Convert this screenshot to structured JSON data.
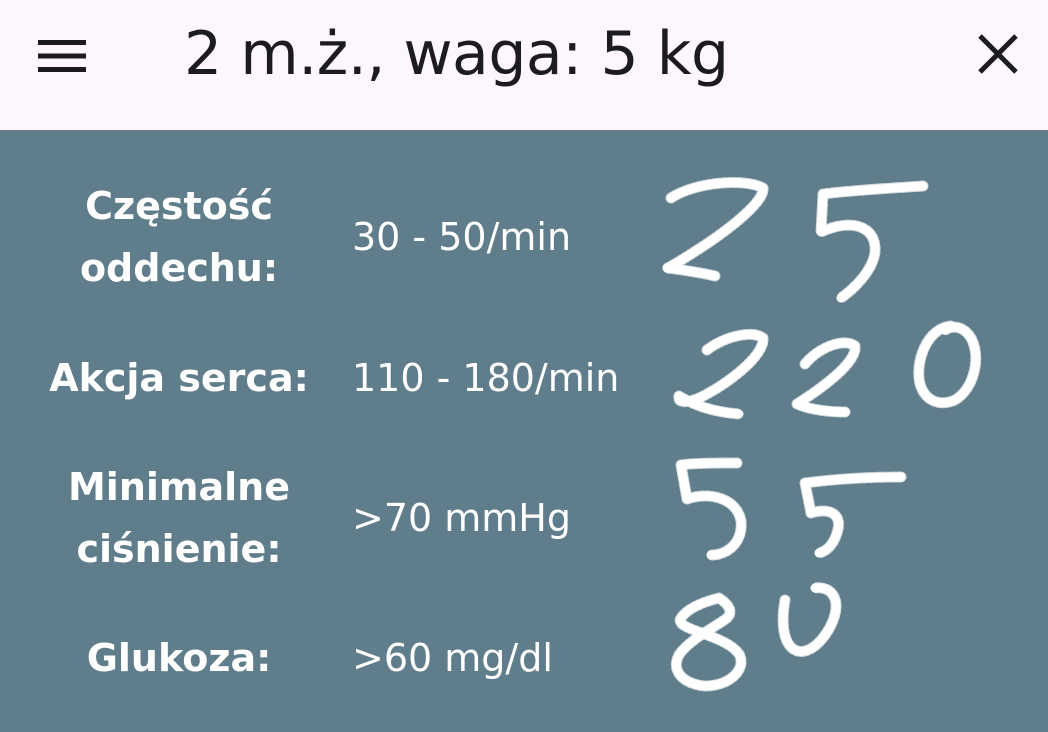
{
  "header": {
    "title": "2 m.ż., waga: 5 kg",
    "menu_icon": "menu-icon",
    "close_icon": "close-icon"
  },
  "rows": [
    {
      "label": "Częstość oddechu:",
      "norm": "30 - 50/min",
      "handwritten": "25"
    },
    {
      "label": "Akcja serca:",
      "norm": "110 - 180/min",
      "handwritten": "220"
    },
    {
      "label": "Minimalne ciśnienie:",
      "norm": ">70 mmHg",
      "handwritten": "55"
    },
    {
      "label": "Glukoza:",
      "norm": ">60 mg/dl",
      "handwritten": "80"
    }
  ],
  "colors": {
    "header_bg": "#fdf6fc",
    "body_bg": "#607d8b",
    "text_light": "#ffffff",
    "text_dark": "#1c1b1f"
  }
}
